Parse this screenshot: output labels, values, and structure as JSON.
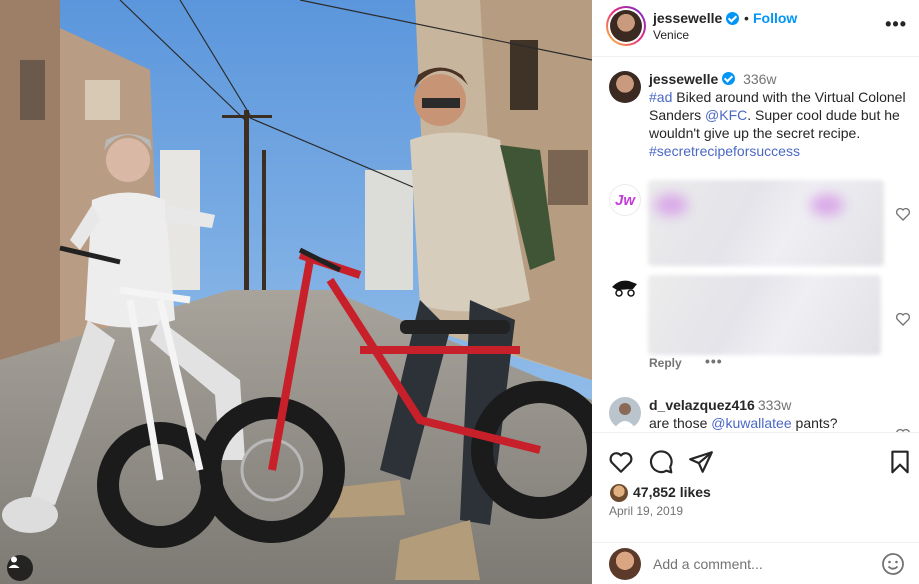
{
  "post": {
    "author": "jessewelle",
    "follow_label": "Follow",
    "separator": "•",
    "location": "Venice",
    "more": "•••"
  },
  "caption": {
    "username": "jessewelle",
    "time": "336w",
    "ad_tag": "#ad",
    "text1": " Biked around with the Virtual Colonel Sanders ",
    "mention": "@KFC",
    "text2": ". Super cool dude but he wouldn't give up the secret recipe. ",
    "hashtag": "#secretrecipeforsuccess"
  },
  "comments": [
    {
      "avatar_text": "Jw",
      "blurred": true
    },
    {
      "blurred": true,
      "reply_label": "Reply",
      "more": "•••"
    },
    {
      "username": "d_velazquez416",
      "time": "333w",
      "text1": "are those ",
      "mention": "@kuwallatee",
      "text2": " pants?"
    }
  ],
  "actions": {
    "likes": "47,852 likes",
    "date": "April 19, 2019"
  },
  "add_comment": {
    "placeholder": "Add a comment..."
  },
  "colors": {
    "link_blue": "#0095f6",
    "hashtag_blue": "#4a68c4",
    "muted": "#737373"
  },
  "icons": [
    "verified-badge-icon",
    "more-options-icon",
    "heart-icon",
    "comment-icon",
    "share-icon",
    "bookmark-icon",
    "emoji-icon",
    "user-tag-icon"
  ]
}
